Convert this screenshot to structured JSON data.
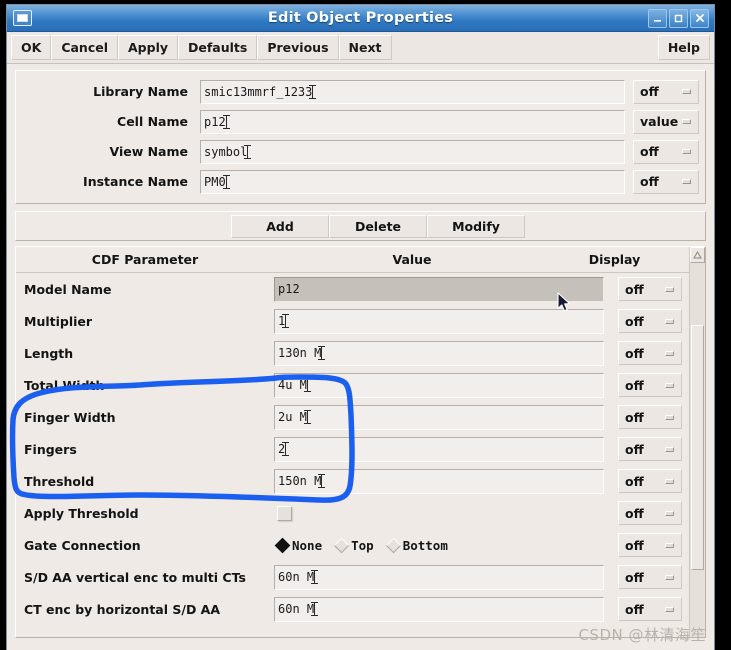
{
  "window": {
    "title": "Edit Object Properties",
    "icon": "window-box-icon",
    "buttons": {
      "minimize": "minimize-icon",
      "maximize": "maximize-icon",
      "close": "close-icon"
    }
  },
  "menubar": {
    "items": [
      "OK",
      "Cancel",
      "Apply",
      "Defaults",
      "Previous",
      "Next"
    ],
    "help": "Help"
  },
  "topform": {
    "rows": [
      {
        "label": "Library Name",
        "value": "smic13mmrf_1233",
        "display": "off"
      },
      {
        "label": "Cell Name",
        "value": "p12",
        "display": "value"
      },
      {
        "label": "View Name",
        "value": "symbol",
        "display": "off"
      },
      {
        "label": "Instance Name",
        "value": "PM0",
        "display": "off"
      }
    ]
  },
  "editbar": {
    "add": "Add",
    "delete": "Delete",
    "modify": "Modify"
  },
  "cdf": {
    "headers": {
      "parameter": "CDF Parameter",
      "value": "Value",
      "display": "Display"
    },
    "rows": [
      {
        "label": "Model Name",
        "type": "readonly",
        "value": "p12",
        "display": "off"
      },
      {
        "label": "Multiplier",
        "type": "text",
        "value": "1",
        "display": "off"
      },
      {
        "label": "Length",
        "type": "text",
        "value": "130n M",
        "display": "off"
      },
      {
        "label": "Total Width",
        "type": "text",
        "value": "4u M",
        "display": "off"
      },
      {
        "label": "Finger Width",
        "type": "text",
        "value": "2u M",
        "display": "off"
      },
      {
        "label": "Fingers",
        "type": "text",
        "value": "2",
        "display": "off"
      },
      {
        "label": "Threshold",
        "type": "text",
        "value": "150n M",
        "display": "off"
      },
      {
        "label": "Apply Threshold",
        "type": "checkbox",
        "checked": false,
        "display": "off"
      },
      {
        "label": "Gate Connection",
        "type": "radio",
        "options": [
          "None",
          "Top",
          "Bottom"
        ],
        "selected": "None",
        "display": "off"
      },
      {
        "label": "S/D AA vertical enc to multi CTs",
        "type": "text",
        "value": "60n M",
        "display": "off"
      },
      {
        "label": "CT enc by horizontal S/D AA",
        "type": "text",
        "value": "60n M",
        "display": "off"
      }
    ]
  },
  "scrollbar": {
    "up": "scroll-up-arrow-icon",
    "thumb": "scroll-thumb"
  },
  "annotation": {
    "color": "#1b5ff0",
    "shape": "hand-drawn-rounded-rectangle",
    "encircles": [
      "Total Width",
      "Finger Width",
      "Fingers"
    ]
  },
  "watermark": {
    "text": "CSDN @林清海笙"
  },
  "colors": {
    "titlebar": "#2f78c2",
    "panel": "#efeae6",
    "field": "#f2eeeb",
    "readonly_field": "#c6c0bb",
    "annotation": "#1b5ff0"
  }
}
